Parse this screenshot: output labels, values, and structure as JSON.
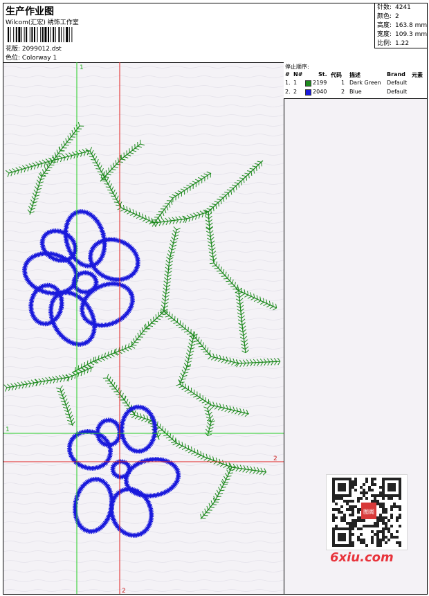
{
  "header": {
    "title": "生产作业图",
    "subtitle": "Wilcom(汇宏) 绣饰工作室",
    "design_label": "花版:",
    "design_value": "2099012.dst",
    "colorway_label": "色位:",
    "colorway_value": "Colorway 1"
  },
  "stats": {
    "stitches_label": "针数:",
    "stitches_value": "4241",
    "colors_label": "颜色:",
    "colors_value": "2",
    "height_label": "高度:",
    "height_value": "163.8 mm",
    "width_label": "宽度:",
    "width_value": "109.3 mm",
    "ratio_label": "比例:",
    "ratio_value": "1.22"
  },
  "stop_sequence": {
    "title": "停止顺序:",
    "headers": {
      "hash": "#",
      "no": "N#",
      "st": "St.",
      "code": "代码",
      "desc": "描述",
      "brand": "Brand",
      "elem": "元素"
    },
    "rows": [
      {
        "num": "1.",
        "n": "1",
        "color": "#1e8a1e",
        "st": "2199",
        "code": "1",
        "desc": "Dark Green",
        "brand": "Default"
      },
      {
        "num": "2.",
        "n": "2",
        "color": "#1a1adc",
        "st": "2040",
        "code": "2",
        "desc": "Blue",
        "brand": "Default"
      }
    ]
  },
  "guides": {
    "green_v_label": "1",
    "green_h_label": "1",
    "red_h_label": "2",
    "red_v_label": "2",
    "green_color": "#22cc22",
    "red_color": "#e02020"
  },
  "thread_colors": {
    "green": "#1e8a1e",
    "blue": "#1a1adc"
  },
  "watermark": {
    "text": "6xiu.com",
    "qr_stamp": "图阁"
  }
}
